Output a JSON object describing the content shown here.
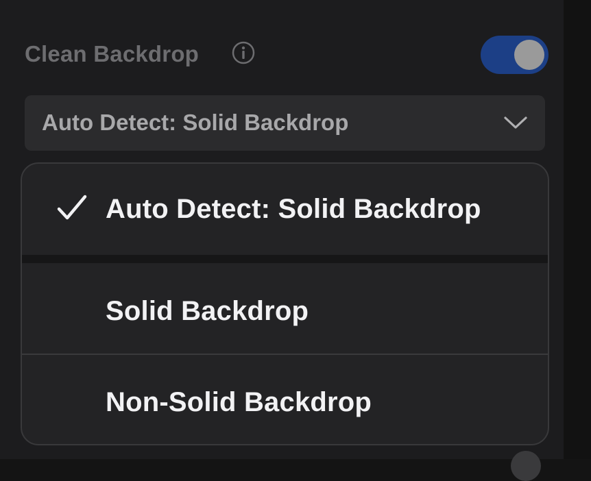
{
  "setting": {
    "label": "Clean Backdrop",
    "info_icon": "info-icon",
    "toggle_on": true
  },
  "select": {
    "value": "Auto Detect: Solid Backdrop",
    "chevron_icon": "chevron-down-icon"
  },
  "dropdown": {
    "options": [
      {
        "label": "Auto Detect: Solid Backdrop",
        "selected": true
      },
      {
        "label": "Solid Backdrop",
        "selected": false
      },
      {
        "label": "Non-Solid Backdrop",
        "selected": false
      }
    ],
    "check_icon": "checkmark-icon"
  },
  "colors": {
    "toggle_on": "#1c3f86",
    "panel_bg": "#1c1c1e",
    "menu_bg": "#232325",
    "label_dim": "#6d6d70",
    "option_text": "#f2f2f4"
  }
}
